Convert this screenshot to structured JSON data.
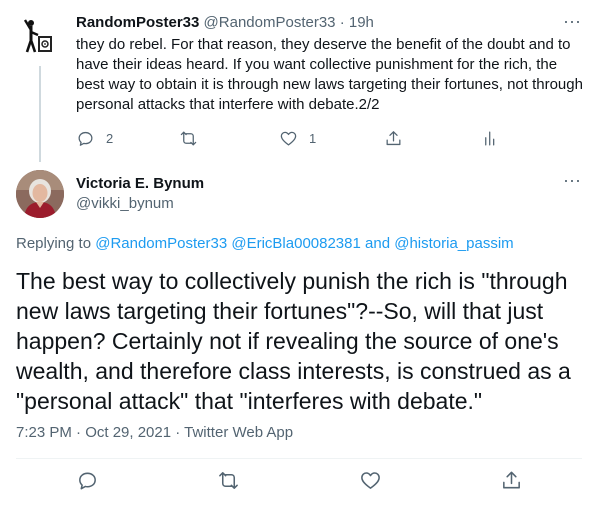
{
  "reply": {
    "display_name": "RandomPoster33",
    "handle": "@RandomPoster33",
    "separator": "·",
    "time": "19h",
    "text": "they do rebel. For that reason, they deserve the benefit of the doubt and to have their ideas heard. If you want collective punishment for the rich, the best way to obtain it is through new laws targeting their fortunes, not through personal attacks that interfere with debate.2/2",
    "reply_count": "2",
    "retweet_count": "",
    "like_count": "1",
    "more_label": "···"
  },
  "main": {
    "display_name": "Victoria E. Bynum",
    "handle": "@vikki_bynum",
    "replying_prefix": "Replying to",
    "replying_user1": "@RandomPoster33",
    "replying_user2": "@EricBla00082381",
    "replying_and": "and",
    "replying_user3": "@historia_passim",
    "text": "The best way to collectively punish the rich is \"through new laws targeting their fortunes\"?--So, will that just happen? Certainly not if revealing the source of one's wealth, and therefore class interests, is construed as a \"personal attack\" that \"interferes with debate.\"",
    "timestamp": "7:23 PM · Oct 29, 2021 · Twitter Web App",
    "more_label": "···"
  },
  "icons": {
    "reply": "reply-icon",
    "retweet": "retweet-icon",
    "like": "heart-icon",
    "share": "share-icon",
    "analytics": "analytics-icon",
    "more": "more-icon"
  },
  "colors": {
    "link": "#1d9bf0",
    "secondary": "#536471",
    "text": "#0f1419",
    "thread_line": "#cfd9de"
  }
}
